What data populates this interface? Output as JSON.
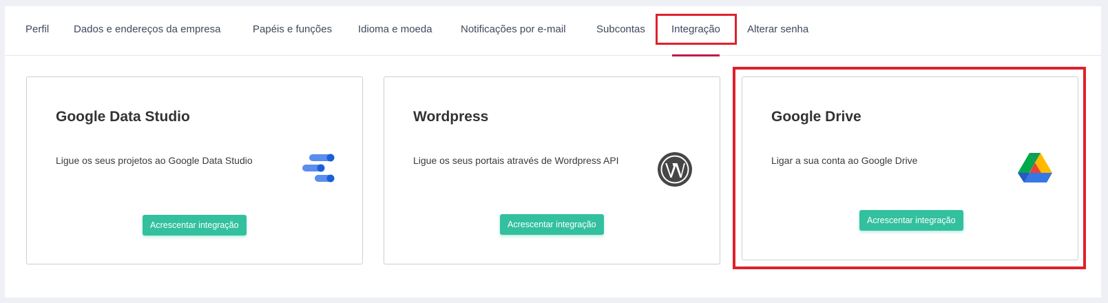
{
  "tabs": [
    {
      "label": "Perfil"
    },
    {
      "label": "Dados e endereços da empresa"
    },
    {
      "label": "Papéis e funções"
    },
    {
      "label": "Idioma e moeda"
    },
    {
      "label": "Notificações por e-mail"
    },
    {
      "label": "Subcontas"
    },
    {
      "label": "Integração",
      "active": true
    },
    {
      "label": "Alterar senha"
    }
  ],
  "cards": [
    {
      "title": "Google Data Studio",
      "description": "Ligue os seus projetos ao Google Data Studio",
      "button_label": "Acrescentar integração",
      "icon": "google-data-studio-icon"
    },
    {
      "title": "Wordpress",
      "description": "Ligue os seus portais através de Wordpress API",
      "button_label": "Acrescentar integração",
      "icon": "wordpress-icon"
    },
    {
      "title": "Google Drive",
      "description": "Ligar a sua conta ao Google Drive",
      "button_label": "Acrescentar integração",
      "icon": "google-drive-icon"
    }
  ],
  "colors": {
    "accent_tab": "#c2164a",
    "button": "#33c09e",
    "highlight": "#e0202a"
  }
}
